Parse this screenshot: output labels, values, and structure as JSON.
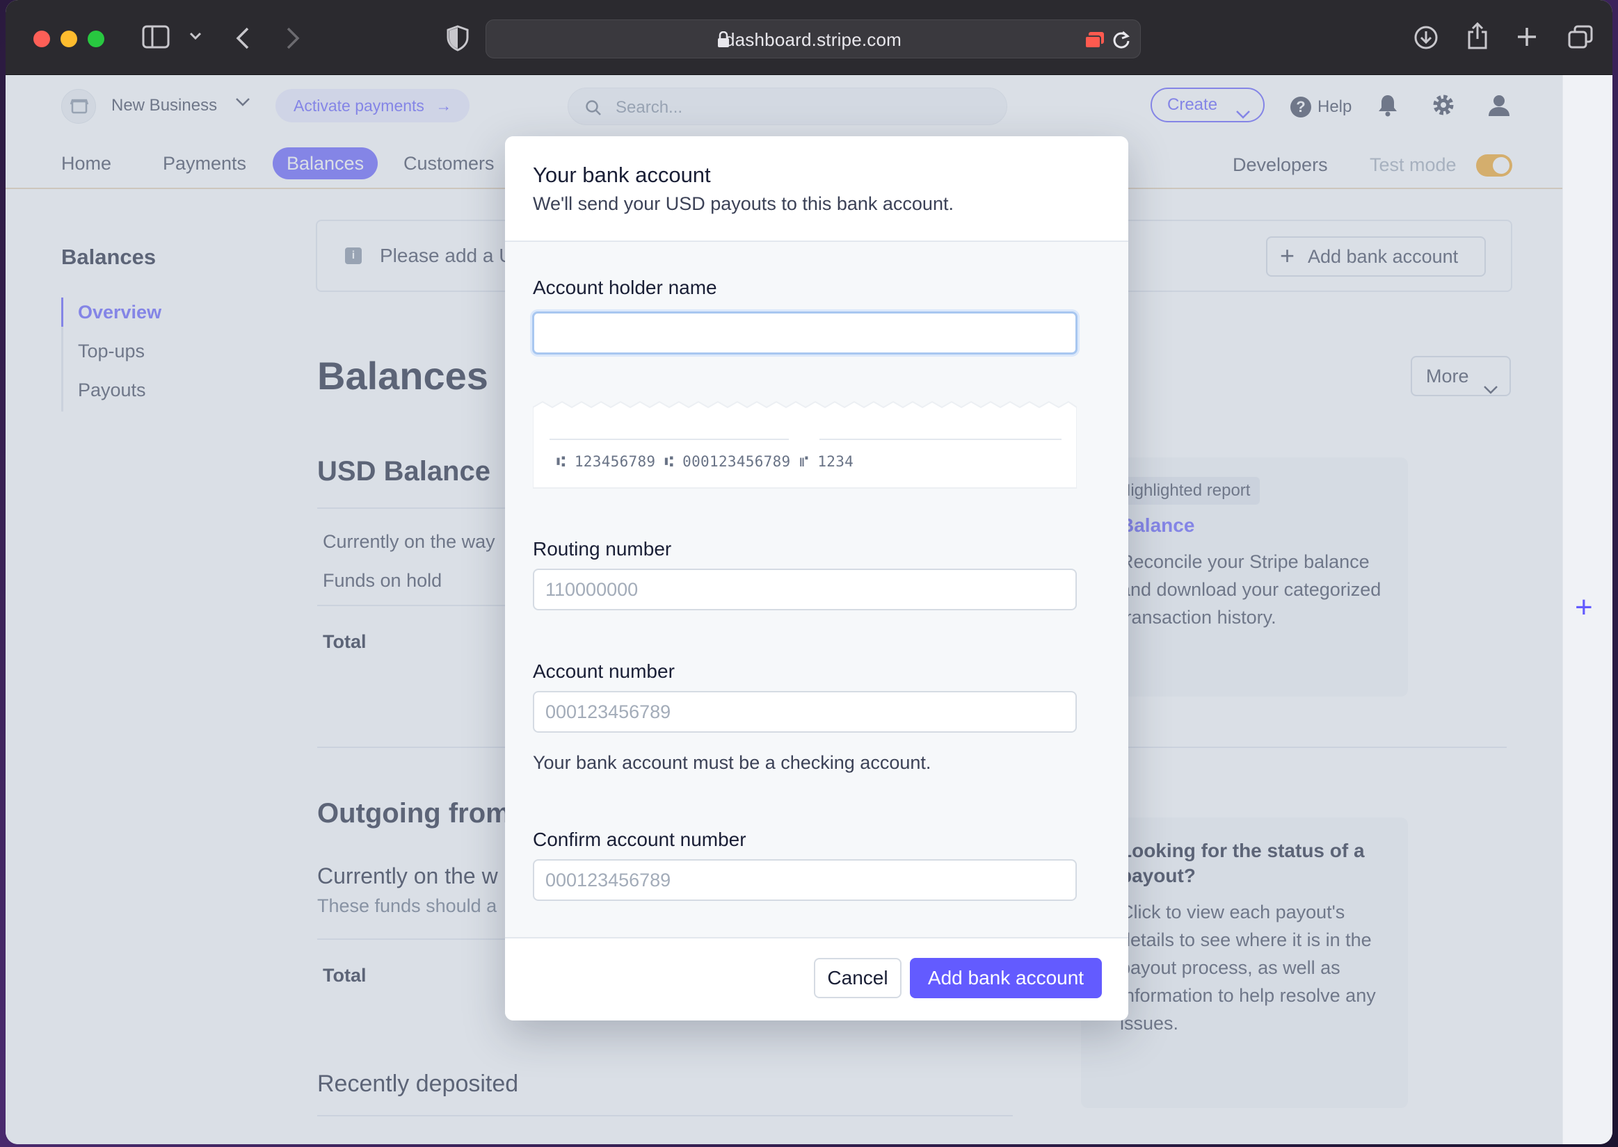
{
  "browser": {
    "url": "dashboard.stripe.com"
  },
  "topbar": {
    "business_name": "New Business",
    "activate_label": "Activate payments",
    "search_placeholder": "Search...",
    "create_label": "Create",
    "help_label": "Help"
  },
  "nav": {
    "items": [
      "Home",
      "Payments",
      "Balances",
      "Customers"
    ],
    "active": "Balances",
    "developers": "Developers",
    "test_mode": "Test mode"
  },
  "sidebar": {
    "title": "Balances",
    "items": [
      "Overview",
      "Top-ups",
      "Payouts"
    ],
    "active": "Overview"
  },
  "banner": {
    "text": "Please add a U",
    "button_label": "Add bank account"
  },
  "main": {
    "heading": "Balances",
    "more_label": "More",
    "usd_heading": "USD Balance",
    "rows": [
      "Currently on the way",
      "Funds on hold"
    ],
    "total_label": "Total",
    "outgoing_heading": "Outgoing from",
    "on_the_way_heading": "Currently on the w",
    "on_the_way_sub": "These funds should a",
    "total_label_2": "Total",
    "recent_heading": "Recently deposited"
  },
  "report_card": {
    "badge": "Highlighted report",
    "link": "Balance",
    "lines": [
      "Reconcile your Stripe balance",
      "and download your categorized",
      "transaction history."
    ]
  },
  "payout_card": {
    "title_lines": [
      "Looking for the status of a",
      "payout?"
    ],
    "lines": [
      "Click to view each payout's",
      "details to see where it is in the",
      "payout process, as well as",
      "information to help resolve any",
      "issues."
    ]
  },
  "modal": {
    "title": "Your bank account",
    "subtitle": "We'll send your USD payouts to this bank account.",
    "holder_label": "Account holder name",
    "holder_value": "",
    "check": {
      "routing": "123456789",
      "account": "000123456789",
      "check_number": "1234"
    },
    "routing_label": "Routing number",
    "routing_placeholder": "110000000",
    "account_label": "Account number",
    "account_placeholder": "000123456789",
    "account_help": "Your bank account must be a checking account.",
    "confirm_label": "Confirm account number",
    "confirm_placeholder": "000123456789",
    "cancel_label": "Cancel",
    "submit_label": "Add bank account"
  },
  "colors": {
    "accent": "#635bff",
    "test_mode_toggle": "#f5a623"
  }
}
